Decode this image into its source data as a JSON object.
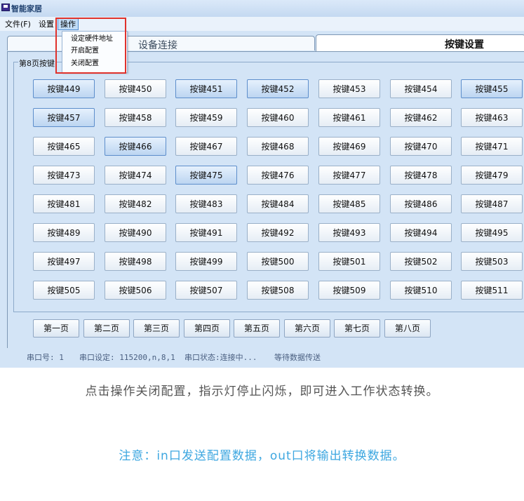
{
  "window": {
    "title": "智能家居",
    "icon": "app-window-icon"
  },
  "menubar": {
    "items": [
      "文件(F)",
      "设置",
      "操作"
    ],
    "active": "操作"
  },
  "dropdown": {
    "items": [
      "设定硬件地址",
      "开启配置",
      "关闭配置"
    ]
  },
  "tabs": [
    {
      "label": "设备连接",
      "selected": false
    },
    {
      "label": "按键设置",
      "selected": true
    }
  ],
  "group": {
    "title": "第8页按键"
  },
  "keys": {
    "prefix": "按键",
    "rows": [
      [
        "按键449",
        "按键450",
        "按键451",
        "按键452",
        "按键453",
        "按键454",
        "按键455"
      ],
      [
        "按键457",
        "按键458",
        "按键459",
        "按键460",
        "按键461",
        "按键462",
        "按键463"
      ],
      [
        "按键465",
        "按键466",
        "按键467",
        "按键468",
        "按键469",
        "按键470",
        "按键471"
      ],
      [
        "按键473",
        "按键474",
        "按键475",
        "按键476",
        "按键477",
        "按键478",
        "按键479"
      ],
      [
        "按键481",
        "按键482",
        "按键483",
        "按键484",
        "按键485",
        "按键486",
        "按键487"
      ],
      [
        "按键489",
        "按键490",
        "按键491",
        "按键492",
        "按键493",
        "按键494",
        "按键495"
      ],
      [
        "按键497",
        "按键498",
        "按键499",
        "按键500",
        "按键501",
        "按键502",
        "按键503"
      ],
      [
        "按键505",
        "按键506",
        "按键507",
        "按键508",
        "按键509",
        "按键510",
        "按键511"
      ]
    ],
    "highlighted": [
      "按键449",
      "按键451",
      "按键452",
      "按键455",
      "按键457",
      "按键466",
      "按键475"
    ]
  },
  "pages": [
    "第一页",
    "第二页",
    "第三页",
    "第四页",
    "第五页",
    "第六页",
    "第七页",
    "第八页"
  ],
  "status": {
    "port": "串口号: 1",
    "settings": "串口设定: 115200,n,8,1",
    "state": "串口状态:连接中...",
    "info": "等待数据传送"
  },
  "captions": {
    "line1": "点击操作关闭配置，指示灯停止闪烁，即可进入工作状态转换。",
    "line2": "注意：in口发送配置数据，out口将输出转换数据。"
  },
  "colors": {
    "accent_red": "#e0322c",
    "caption_blue": "#3ea7e0",
    "panel_bg": "#d3e4f6"
  }
}
